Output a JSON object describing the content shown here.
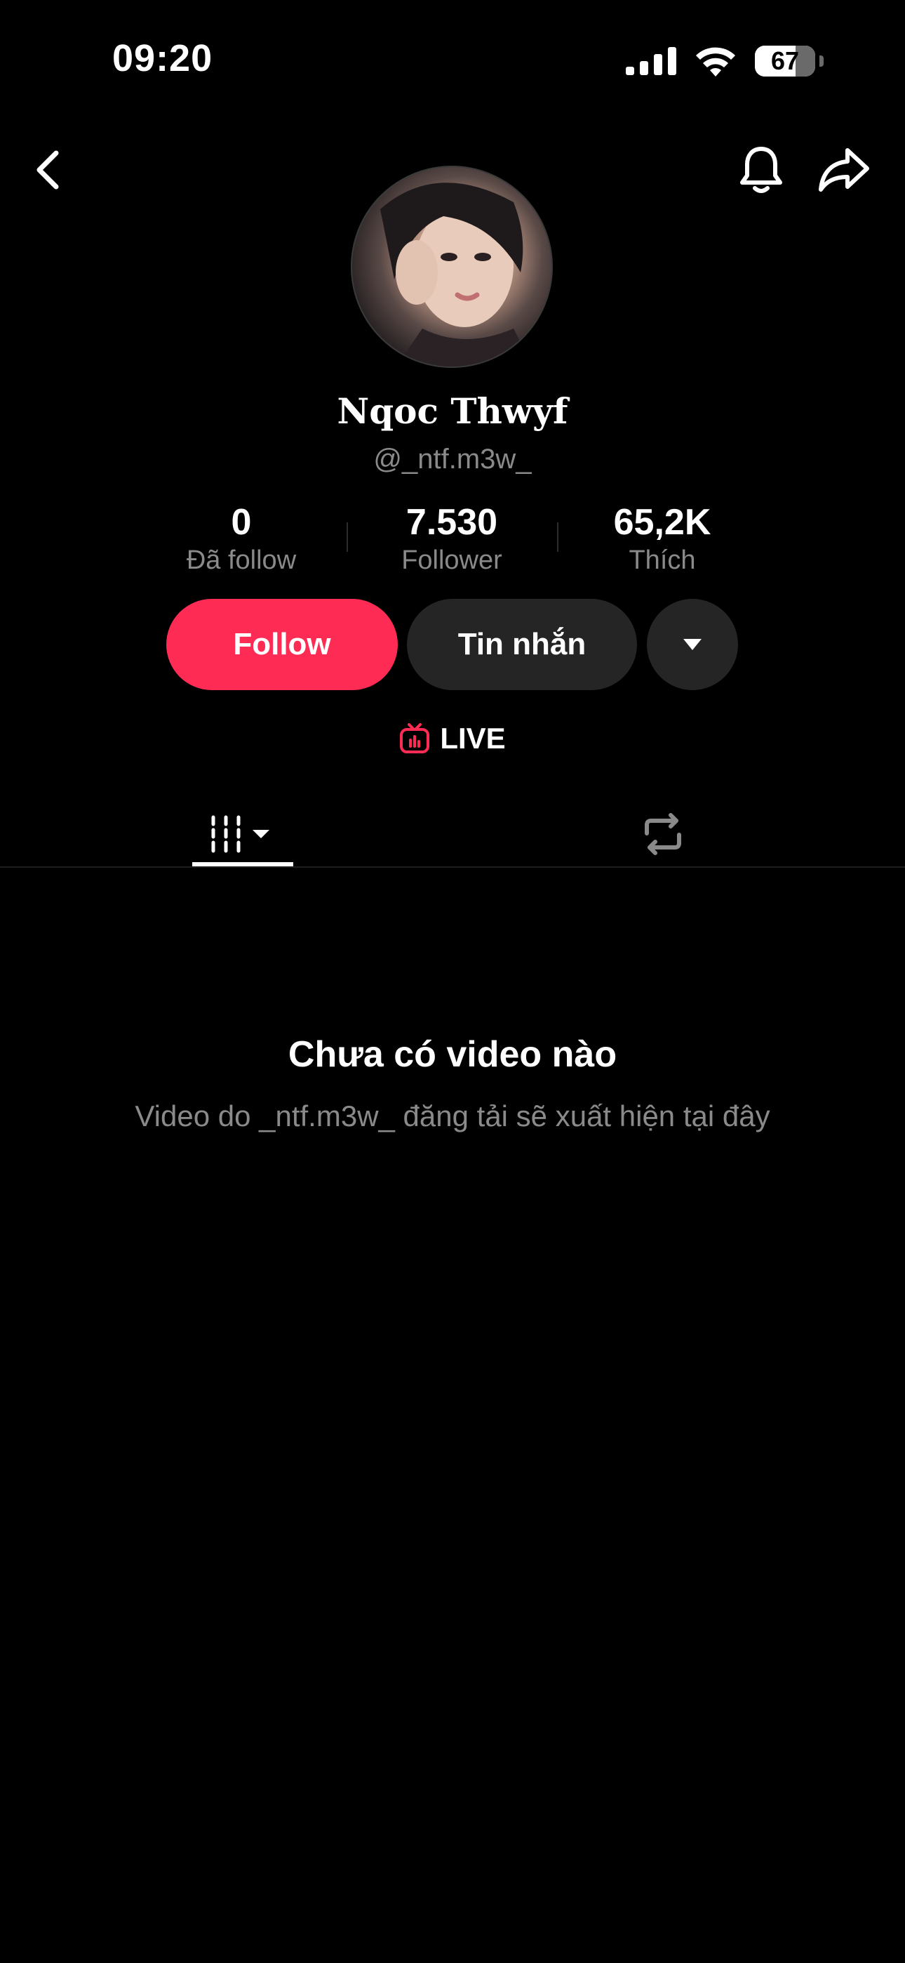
{
  "status_bar": {
    "time": "09:20",
    "battery_percent": "67",
    "battery_level": 0.67,
    "icons": [
      "signal-icon",
      "wifi-icon",
      "battery-icon"
    ]
  },
  "nav": {
    "icons": [
      "back-chevron-icon",
      "bell-icon",
      "share-arrow-icon"
    ]
  },
  "profile": {
    "display_name": "Nqoc Thwyf",
    "handle": "@_ntf.m3w_"
  },
  "stats": [
    {
      "value": "0",
      "label": "Đã follow"
    },
    {
      "value": "7.530",
      "label": "Follower"
    },
    {
      "value": "65,2K",
      "label": "Thích"
    }
  ],
  "actions": {
    "follow_label": "Follow",
    "message_label": "Tin nhắn"
  },
  "live": {
    "label": "LIVE"
  },
  "tabs": {
    "icons": [
      "grid-icon",
      "repost-icon"
    ]
  },
  "empty_state": {
    "title": "Chưa có video nào",
    "subtitle": "Video do _ntf.m3w_ đăng tải sẽ xuất hiện tại đây"
  },
  "colors": {
    "background": "#000000",
    "accent": "#fe2c55",
    "secondary_button": "#252525",
    "muted_text": "#8a8a8a"
  }
}
